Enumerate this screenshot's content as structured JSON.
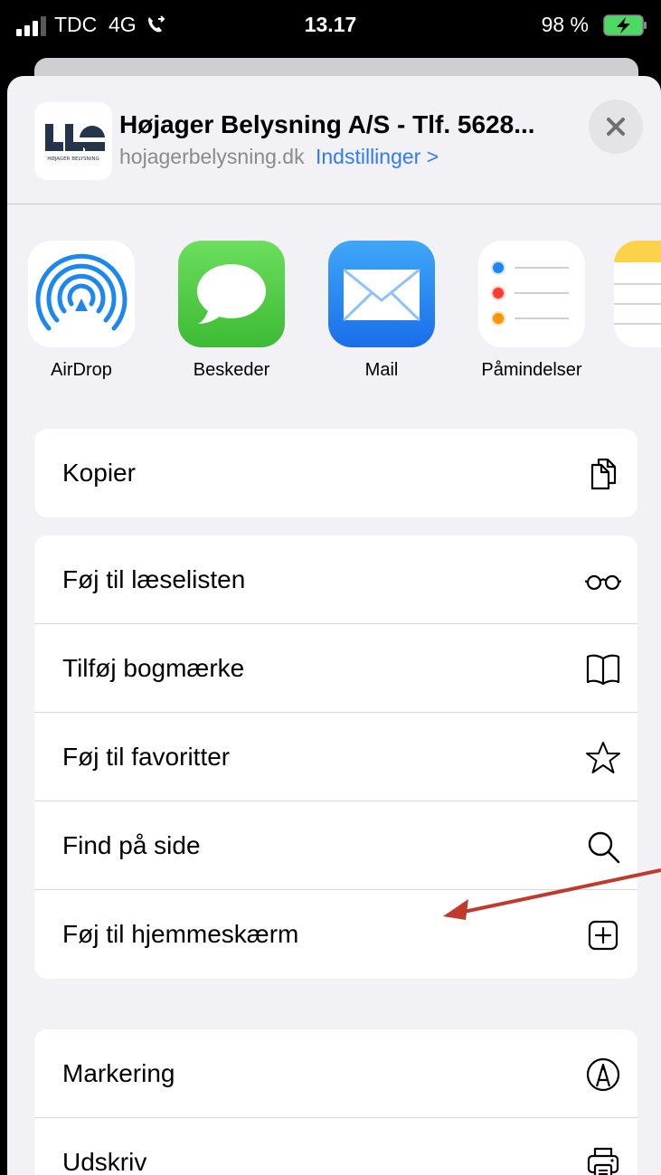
{
  "status_bar": {
    "carrier": "TDC",
    "network": "4G",
    "time": "13.17",
    "battery_percent": "98 %"
  },
  "header": {
    "site_title": "Højager Belysning A/S - Tlf. 5628...",
    "site_domain": "hojagerbelysning.dk",
    "settings_link": "Indstillinger >",
    "logo_caption": "HØJAGER BELYSNING"
  },
  "apps": [
    {
      "label": "AirDrop",
      "icon": "airdrop-icon"
    },
    {
      "label": "Beskeder",
      "icon": "messages-icon"
    },
    {
      "label": "Mail",
      "icon": "mail-icon"
    },
    {
      "label": "Påmindelser",
      "icon": "reminders-icon"
    }
  ],
  "groups": [
    [
      {
        "label": "Kopier",
        "icon": "copy-icon"
      }
    ],
    [
      {
        "label": "Føj til læselisten",
        "icon": "glasses-icon"
      },
      {
        "label": "Tilføj bogmærke",
        "icon": "book-icon"
      },
      {
        "label": "Føj til favoritter",
        "icon": "star-icon"
      },
      {
        "label": "Find på side",
        "icon": "search-icon"
      },
      {
        "label": "Føj til hjemmeskærm",
        "icon": "add-square-icon"
      }
    ],
    [
      {
        "label": "Markering",
        "icon": "markup-icon"
      },
      {
        "label": "Udskriv",
        "icon": "printer-icon"
      }
    ]
  ],
  "colors": {
    "link": "#2f7bf6",
    "annotation_arrow": "#c0392b",
    "battery_green": "#4cd964"
  }
}
